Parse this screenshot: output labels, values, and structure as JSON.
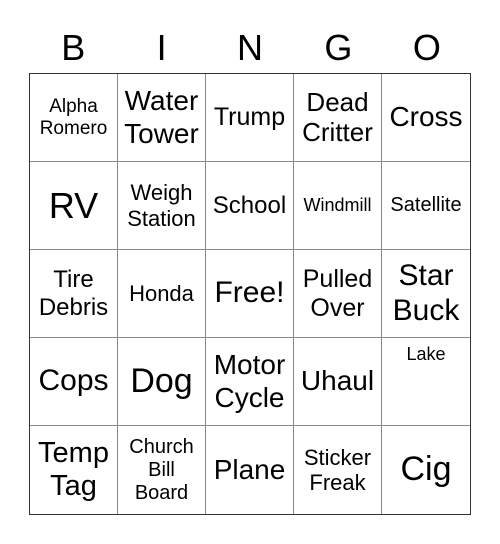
{
  "header": [
    "B",
    "I",
    "N",
    "G",
    "O"
  ],
  "cells": [
    "Alpha Romero",
    "Water Tower",
    "Trump",
    "Dead Critter",
    "Cross",
    "RV",
    "Weigh Station",
    "School",
    "Windmill",
    "Satellite",
    "Tire Debris",
    "Honda",
    "Free!",
    "Pulled Over",
    "Star Buck",
    "Cops",
    "Dog",
    "Motor Cycle",
    "Uhaul",
    "Lake",
    "Temp Tag",
    "Church Bill Board",
    "Plane",
    "Sticker Freak",
    "Cig"
  ]
}
